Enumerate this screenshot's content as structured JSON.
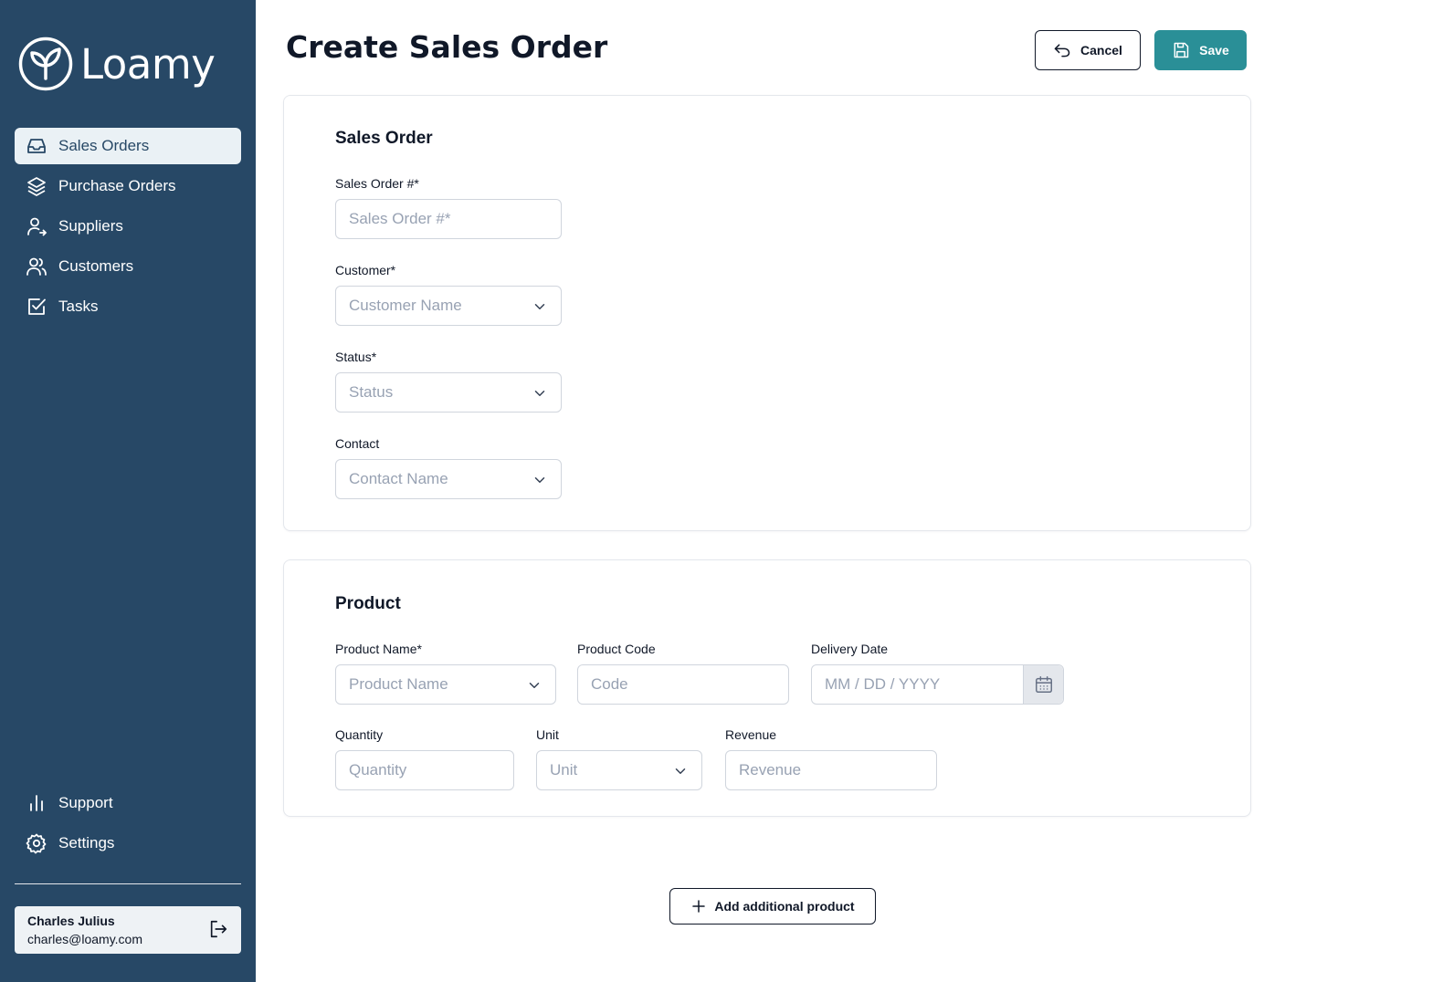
{
  "app": {
    "logo_text": "Loamy"
  },
  "header": {
    "title": "Create Sales Order",
    "cancel_label": "Cancel",
    "save_label": "Save"
  },
  "sidebar": {
    "items": [
      {
        "label": "Sales Orders",
        "icon": "inbox-icon",
        "active": true
      },
      {
        "label": "Purchase Orders",
        "icon": "layers-icon"
      },
      {
        "label": "Suppliers",
        "icon": "user-arrow-icon"
      },
      {
        "label": "Customers",
        "icon": "users-icon"
      },
      {
        "label": "Tasks",
        "icon": "check-square-icon"
      }
    ],
    "bottom_items": [
      {
        "label": "Support",
        "icon": "bar-chart-icon"
      },
      {
        "label": "Settings",
        "icon": "gear-icon"
      }
    ],
    "user": {
      "name": "Charles Julius",
      "email": "charles@loamy.com"
    }
  },
  "sales_order": {
    "title": "Sales Order",
    "order_number": {
      "label": "Sales Order #*",
      "placeholder": "Sales Order #*"
    },
    "customer": {
      "label": "Customer*",
      "placeholder": "Customer Name"
    },
    "status": {
      "label": "Status*",
      "placeholder": "Status"
    },
    "contact": {
      "label": "Contact",
      "placeholder": "Contact Name"
    }
  },
  "product": {
    "title": "Product",
    "name": {
      "label": "Product Name*",
      "placeholder": "Product Name"
    },
    "code": {
      "label": "Product Code",
      "placeholder": "Code"
    },
    "delivery_date": {
      "label": "Delivery Date",
      "placeholder": "MM / DD / YYYY"
    },
    "quantity": {
      "label": "Quantity",
      "placeholder": "Quantity"
    },
    "unit": {
      "label": "Unit",
      "placeholder": "Unit"
    },
    "revenue": {
      "label": "Revenue",
      "placeholder": "Revenue"
    }
  },
  "actions": {
    "add_product_label": "Add additional product"
  },
  "colors": {
    "sidebar_bg": "#274866",
    "accent": "#2a8f97",
    "active_nav_bg": "#eaf1f5"
  }
}
